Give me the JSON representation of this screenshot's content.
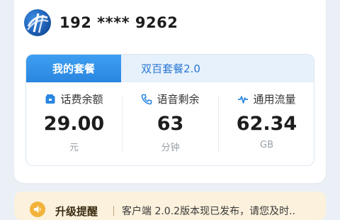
{
  "user": {
    "avatar_icon": "telecom-logo-icon",
    "phone": "192 **** 9262"
  },
  "plan_tabs": [
    {
      "label": "我的套餐",
      "active": true
    },
    {
      "label": "双百套餐2.0",
      "active": false
    }
  ],
  "stats": [
    {
      "icon": "wallet-icon",
      "label": "话费余额",
      "value": "29.00",
      "unit": "元"
    },
    {
      "icon": "phone-icon",
      "label": "语音剩余",
      "value": "63",
      "unit": "分钟"
    },
    {
      "icon": "pulse-icon",
      "label": "通用流量",
      "value": "62.34",
      "unit": "GB"
    }
  ],
  "notice": {
    "icon": "speaker-icon",
    "title": "升级提醒",
    "text": "客户端 2.0.2版本现已发布，请您及时.."
  },
  "colors": {
    "accent": "#2a86e0",
    "page_bg": "#eaf0f6",
    "notice_bg": "#fbf1dc",
    "notice_icon": "#f2b33c"
  }
}
